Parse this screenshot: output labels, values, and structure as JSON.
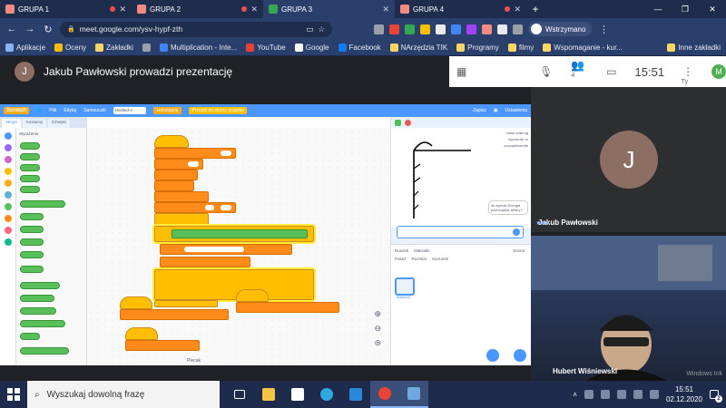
{
  "browser": {
    "tabs": [
      {
        "label": "GRUPA 1",
        "color": "#f28b82",
        "active": false
      },
      {
        "label": "GRUPA 2",
        "color": "#f28b82",
        "active": false
      },
      {
        "label": "GRUPA 3",
        "color": "#34a853",
        "active": true
      },
      {
        "label": "GRUPA 4",
        "color": "#f28b82",
        "active": false
      }
    ],
    "close_glyph": "✕",
    "new_tab_glyph": "+",
    "url": "meet.google.com/ysv-hypf-zth",
    "paused_label": "Wstrzymano",
    "bookmarks": [
      {
        "label": "Aplikacje",
        "color": "#8ab4f8"
      },
      {
        "label": "Oceny",
        "color": "#fbbc04"
      },
      {
        "label": "Zakładki",
        "color": "#fdd663"
      },
      {
        "label": "",
        "color": "#9aa0a6"
      },
      {
        "label": "Multiplication - Inte...",
        "color": "#4285f4"
      },
      {
        "label": "YouTube",
        "color": "#ea4335"
      },
      {
        "label": "Google",
        "color": "#ffffff"
      },
      {
        "label": "Facebook",
        "color": "#1877f2"
      },
      {
        "label": "NArzędzia TIK",
        "color": "#fdd663"
      },
      {
        "label": "Programy",
        "color": "#fdd663"
      },
      {
        "label": "filmy",
        "color": "#fdd663"
      },
      {
        "label": "Wspomaganie - kur...",
        "color": "#fdd663"
      }
    ],
    "other_bookmarks": "Inne zakładki"
  },
  "meet": {
    "presenter_initial": "J",
    "presenter_text": "Jakub Pawłowski prowadzi prezentację",
    "clock": "15:51",
    "participants_count": "4",
    "me_initial": "M",
    "me_label": "Ty",
    "tiles": [
      {
        "name": "Jakub Pawłowski",
        "initial": "J"
      },
      {
        "name": "Hubert Wiśniewski"
      }
    ],
    "watermark": "Windows Ink"
  },
  "scratch": {
    "logo": "Scratch",
    "menu": [
      "Plik",
      "Edytuj",
      "Samouczki"
    ],
    "project_title": "Untitled-4",
    "share_label": "Udostępnij",
    "see_project": "Przejdź do strony projektu",
    "save_label": "Zapisz",
    "user": "Ustawienia",
    "tabs": [
      "Skrypt",
      "Kostiumy",
      "Dźwięki"
    ],
    "category": "Wyrażenia",
    "backpack": "Plecak",
    "sprite_label": "Duszek",
    "sprite_name": "Maksiaki",
    "sprite_thumb": "Maksiaki",
    "show_label": "Pokaż",
    "size_label": "Rozmiar",
    "direction_label": "Kierunek",
    "stage_label": "Scena",
    "speech": "ile wynosi Energia potencjalna aktory?",
    "var_labels": [
      "masa ciała kg",
      "wysokość m",
      "przyspieszenie"
    ]
  },
  "taskbar": {
    "search_placeholder": "Wyszukaj dowolną frazę",
    "time": "15:51",
    "date": "02.12.2020",
    "notifications": "2"
  }
}
